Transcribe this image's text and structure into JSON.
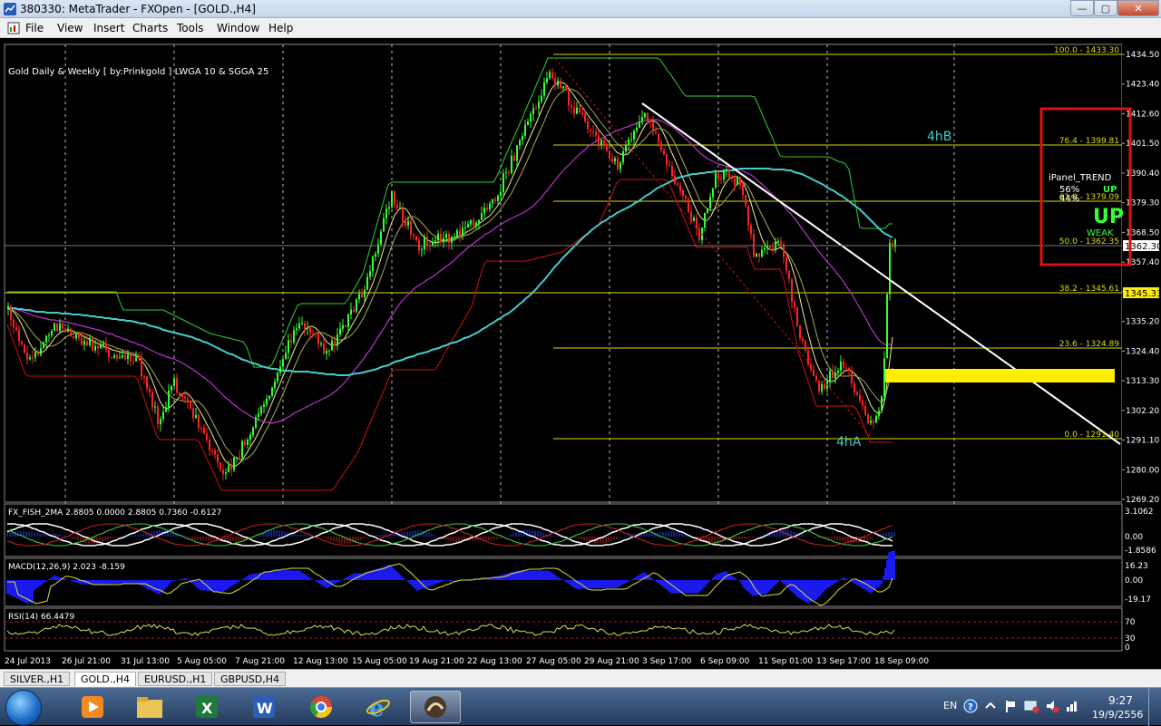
{
  "window": {
    "title": "380330: MetaTrader - FXOpen - [GOLD.,H4]"
  },
  "menu": [
    "File",
    "View",
    "Insert",
    "Charts",
    "Tools",
    "Window",
    "Help"
  ],
  "chart": {
    "indicator_label": "Gold Daily & Weekly [ by:Prinkgold ]  LWGA 10  &  SGGA 25",
    "price_axis": [
      "1434.50",
      "1423.40",
      "1412.60",
      "1401.50",
      "1390.40",
      "1379.30",
      "1368.50",
      "1357.40",
      "1346.30",
      "1335.20",
      "1324.40",
      "1313.30",
      "1302.20",
      "1291.10",
      "1280.00",
      "1269.20"
    ],
    "current_price": "1362.30",
    "fib_label_price": "1345.33",
    "fib_levels": [
      {
        "label": "100.0 - 1433.30"
      },
      {
        "label": "76.4 - 1399.81"
      },
      {
        "label": "61.8 - 1379.09"
      },
      {
        "label": "50.0 - 1362.35"
      },
      {
        "label": "38.2 - 1345.61"
      },
      {
        "label": "23.6 - 1324.89"
      },
      {
        "label": "0.0 - 1291.40"
      }
    ],
    "annotations": {
      "upper": "4hB",
      "lower": "4hA"
    },
    "panel": {
      "title": "iPanel_TREND",
      "pct1": "56%",
      "pct2": "44%",
      "small_dir": "UP",
      "big_dir": "UP",
      "strength": "WEAK"
    },
    "time_axis": [
      "24 Jul 2013",
      "26 Jul 21:00",
      "31 Jul 13:00",
      "5 Aug 05:00",
      "7 Aug 21:00",
      "12 Aug 13:00",
      "15 Aug 05:00",
      "19 Aug 21:00",
      "22 Aug 13:00",
      "27 Aug 05:00",
      "29 Aug 21:00",
      "3 Sep 17:00",
      "6 Sep 09:00",
      "11 Sep 01:00",
      "13 Sep 17:00",
      "18 Sep 09:00"
    ],
    "colors": {
      "up": "#33ff33",
      "down": "#ff2222",
      "fib": "#dddd00",
      "trend": "#ffffff",
      "cyan_ma": "#44cccc",
      "purple_ma": "#bb33cc",
      "channel": "#cc1111"
    }
  },
  "fisher": {
    "label": "FX_FISH_2MA 2.8805 0.0000 2.8805 0.7360 -0.6127",
    "axis": [
      "3.1062",
      "0.00",
      "-1.8586"
    ]
  },
  "macd": {
    "label": "MACD(12,26,9) 2.023 -8.159",
    "axis": [
      "16.23",
      "0.00",
      "-19.17"
    ]
  },
  "rsi": {
    "label": "RSI(14) 66.4479",
    "axis": [
      "70",
      "30",
      "0"
    ]
  },
  "tabs": [
    {
      "label": "SILVER.,H1",
      "active": false
    },
    {
      "label": "GOLD.,H4",
      "active": true
    },
    {
      "label": "EURUSD.,H1",
      "active": false
    },
    {
      "label": "GBPUSD,H4",
      "active": false
    }
  ],
  "taskbar": {
    "apps": [
      "media-player",
      "file-explorer",
      "excel",
      "word",
      "chrome",
      "internet-explorer",
      "metatrader"
    ],
    "lang": "EN",
    "time": "9:27",
    "date": "19/9/2556"
  }
}
